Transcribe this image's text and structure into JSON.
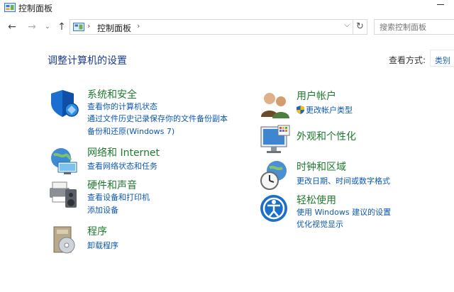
{
  "window": {
    "title": "控制面板"
  },
  "nav": {
    "breadcrumb": "控制面板",
    "search_placeholder": "搜索控制面板"
  },
  "header": {
    "page_title": "调整计算机的设置",
    "view_by_label": "查看方式:",
    "view_by_value": "类别"
  },
  "left_categories": [
    {
      "title": "系统和安全",
      "icon": "security-shield-icon",
      "links": [
        "查看你的计算机状态",
        "通过文件历史记录保存你的文件备份副本",
        "备份和还原(Windows 7)"
      ]
    },
    {
      "title": "网络和 Internet",
      "icon": "network-globe-icon",
      "links": [
        "查看网络状态和任务"
      ]
    },
    {
      "title": "硬件和声音",
      "icon": "printer-speaker-icon",
      "links": [
        "查看设备和打印机",
        "添加设备"
      ]
    },
    {
      "title": "程序",
      "icon": "programs-disc-icon",
      "links": [
        "卸载程序"
      ]
    }
  ],
  "right_categories": [
    {
      "title": "用户帐户",
      "icon": "users-icon",
      "links": [
        "更改帐户类型"
      ]
    },
    {
      "title": "外观和个性化",
      "icon": "monitor-personalize-icon",
      "links": []
    },
    {
      "title": "时钟和区域",
      "icon": "clock-globe-icon",
      "links": [
        "更改日期、时间或数字格式"
      ]
    },
    {
      "title": "轻松使用",
      "icon": "ease-of-access-icon",
      "links": [
        "使用 Windows 建议的设置",
        "优化视觉显示"
      ]
    }
  ],
  "colors": {
    "category_title": "#1e7a2e",
    "link": "#0b58b5",
    "page_title": "#1a3c8c"
  }
}
